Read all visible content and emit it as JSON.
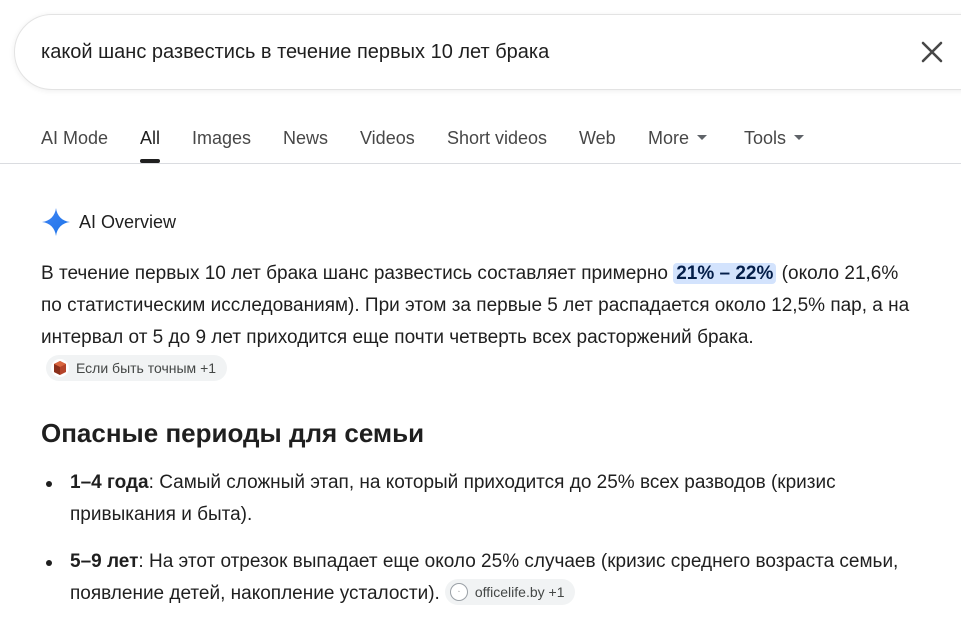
{
  "search": {
    "query": "какой шанс развестись в течение первых 10 лет брака"
  },
  "tabs": [
    {
      "label": "AI Mode"
    },
    {
      "label": "All"
    },
    {
      "label": "Images"
    },
    {
      "label": "News"
    },
    {
      "label": "Videos"
    },
    {
      "label": "Short videos"
    },
    {
      "label": "Web"
    },
    {
      "label": "More"
    },
    {
      "label": "Tools"
    }
  ],
  "ai_overview": {
    "label": "AI Overview",
    "paragraph_before": "В течение первых 10 лет брака шанс развестись составляет примерно ",
    "highlight": "21% – 22%",
    "paragraph_after": " (около 21,6% по статистическим исследованиям). При этом за первые 5 лет распадается около 12,5% пар, а на интервал от 5 до 9 лет приходится еще почти четверть всех расторжений брака.",
    "source_chip": "Если быть точным +1"
  },
  "section": {
    "title": "Опасные периоды для семьи"
  },
  "bullets": [
    {
      "bold": "1–4 года",
      "text": ": Самый сложный этап, на который приходится до 25% всех разводов (кризис привыкания и быта)."
    },
    {
      "bold": "5–9 лет",
      "text": ": На этот отрезок выпадает еще около 25% случаев (кризис среднего возраста семьи, появление детей, накопление усталости).",
      "chip": "officelife.by +1"
    }
  ],
  "colors": {
    "highlight_bg": "#d3e3fd",
    "ai_star": "#4285f4"
  }
}
